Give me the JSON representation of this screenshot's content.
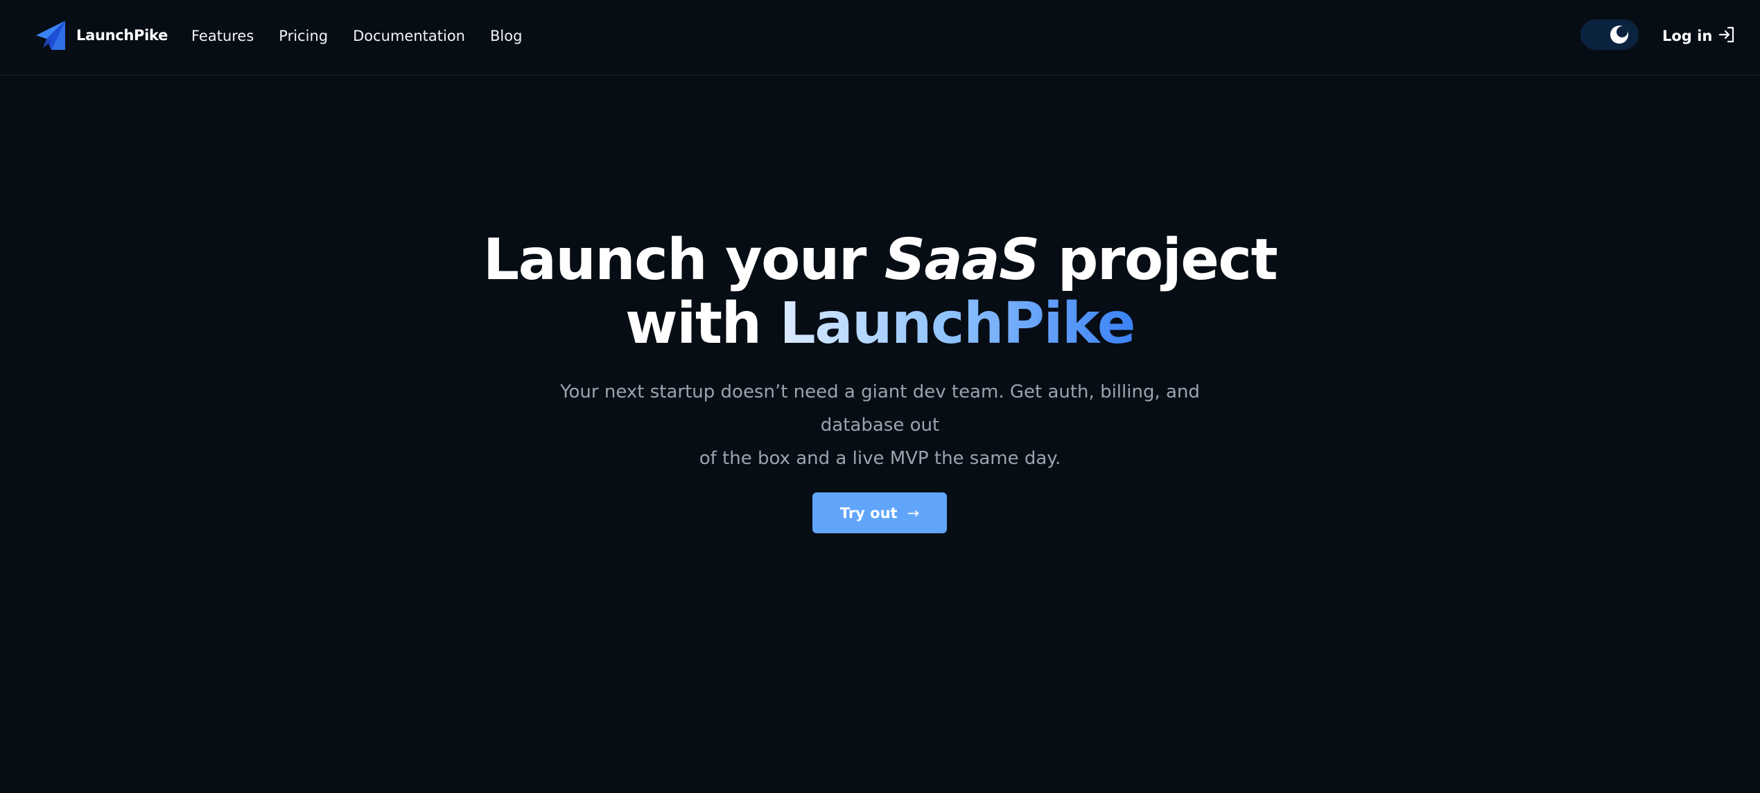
{
  "brand": {
    "name": "LaunchPike",
    "logo_icon": "paper-plane-icon",
    "accent": "#2f6fe6"
  },
  "nav": {
    "items": [
      {
        "label": "Features"
      },
      {
        "label": "Pricing"
      },
      {
        "label": "Documentation"
      },
      {
        "label": "Blog"
      }
    ]
  },
  "header_actions": {
    "theme_toggle_icon": "moon-icon",
    "login_label": "Log in",
    "login_icon": "sign-in-icon"
  },
  "hero": {
    "title_part1": "Launch your ",
    "title_em": "SaaS",
    "title_part2": " project",
    "title_line2_prefix": "with ",
    "title_brand": "LaunchPike",
    "subtitle_line1": "Your next startup doesn’t need a giant dev team. Get auth, billing, and database out",
    "subtitle_line2": "of the box and a live MVP the same day.",
    "cta_label": "Try out",
    "cta_arrow": "→"
  },
  "colors": {
    "background": "#070d14",
    "cta": "#60a5fa",
    "toggle_bg": "#0c2340",
    "subtitle": "#9ca3af"
  }
}
